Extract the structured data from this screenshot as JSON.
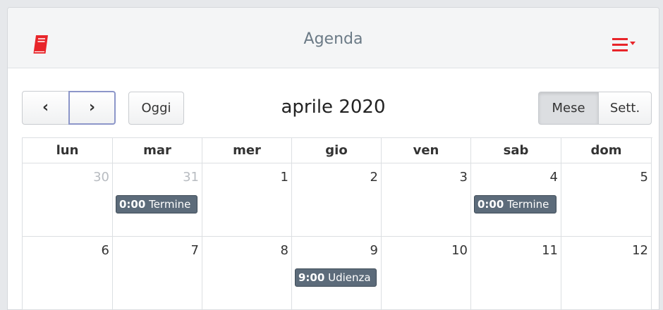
{
  "header": {
    "title": "Agenda",
    "left_icon": "book-icon",
    "right_icon": "menu-dropdown-icon"
  },
  "toolbar": {
    "prev_label": "‹",
    "next_label": "›",
    "today_label": "Oggi",
    "title": "aprile 2020",
    "month_label": "Mese",
    "week_label": "Sett.",
    "active_view": "Mese"
  },
  "calendar": {
    "weekdays": [
      "lun",
      "mar",
      "mer",
      "gio",
      "ven",
      "sab",
      "dom"
    ],
    "weeks": [
      [
        {
          "day": "30",
          "other": true
        },
        {
          "day": "31",
          "other": true,
          "event": {
            "time": "0:00",
            "title": "Termine"
          }
        },
        {
          "day": "1"
        },
        {
          "day": "2"
        },
        {
          "day": "3"
        },
        {
          "day": "4",
          "event": {
            "time": "0:00",
            "title": "Termine"
          }
        },
        {
          "day": "5"
        }
      ],
      [
        {
          "day": "6"
        },
        {
          "day": "7"
        },
        {
          "day": "8"
        },
        {
          "day": "9",
          "event": {
            "time": "9:00",
            "title": "Udienza"
          }
        },
        {
          "day": "10"
        },
        {
          "day": "11"
        },
        {
          "day": "12"
        }
      ]
    ]
  },
  "colors": {
    "accent_red": "#e8252a",
    "event_bg": "#5c6b7a",
    "title_gray": "#6b7a86"
  }
}
